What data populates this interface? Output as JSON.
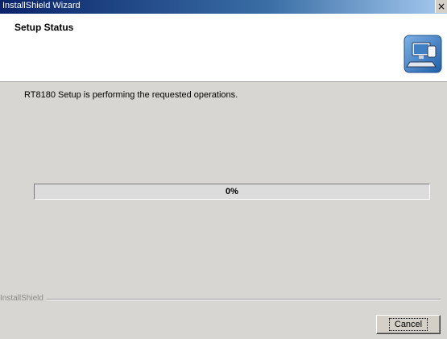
{
  "window": {
    "title": "InstallShield Wizard"
  },
  "header": {
    "title": "Setup Status"
  },
  "body": {
    "status_text": "RT8180 Setup is performing the requested operations.",
    "progress_percent": 0,
    "progress_label": "0%"
  },
  "footer": {
    "brand": "InstallShield",
    "cancel_label": "Cancel"
  },
  "icons": {
    "header_icon": "computer-setup-icon",
    "close_icon": "close-icon"
  }
}
